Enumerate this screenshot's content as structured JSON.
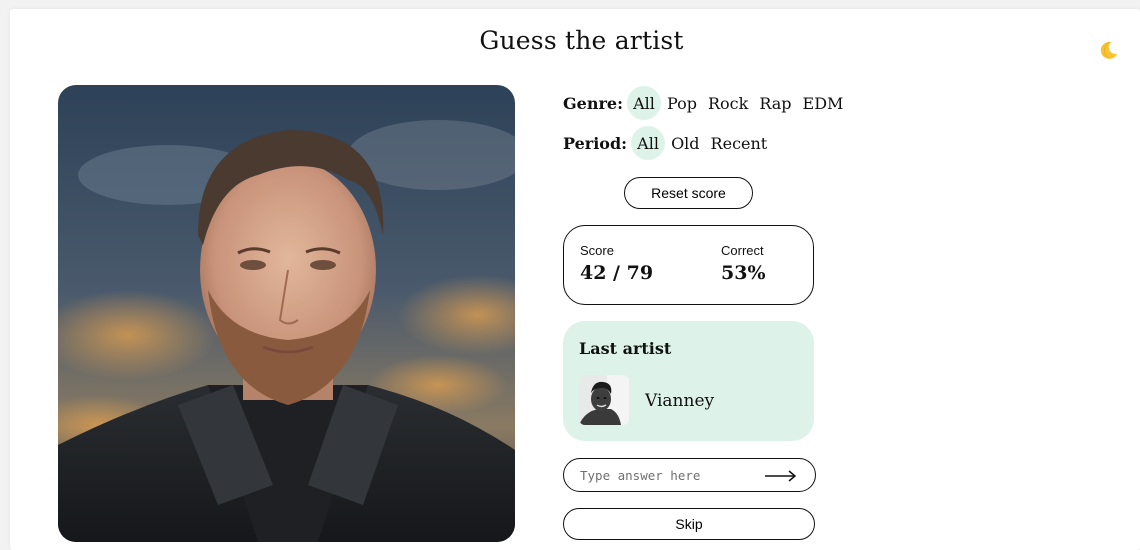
{
  "header": {
    "title": "Guess the artist",
    "theme_toggle_icon": "moon-icon"
  },
  "photo": {
    "alt": "artist-photo"
  },
  "filters": {
    "genre": {
      "label": "Genre:",
      "options": [
        "All",
        "Pop",
        "Rock",
        "Rap",
        "EDM"
      ],
      "selected": "All"
    },
    "period": {
      "label": "Period:",
      "options": [
        "All",
        "Old",
        "Recent"
      ],
      "selected": "All"
    }
  },
  "reset_label": "Reset score",
  "stats": {
    "score_label": "Score",
    "score_value": "42 / 79",
    "correct_label": "Correct",
    "correct_value": "53%"
  },
  "last_artist": {
    "heading": "Last artist",
    "name": "Vianney"
  },
  "answer": {
    "placeholder": "Type answer here",
    "submit_icon": "arrow-right-icon"
  },
  "skip_label": "Skip",
  "colors": {
    "accent": "#ddf3ea",
    "border": "#111111",
    "background": "#ffffff"
  }
}
